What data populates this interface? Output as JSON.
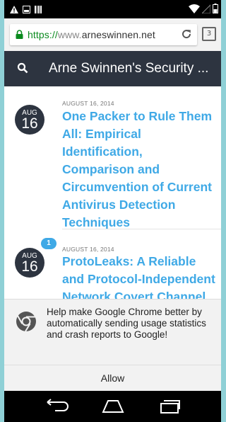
{
  "browser": {
    "url_scheme": "https://",
    "url_prefix": "www.",
    "url_domain": "arneswinnen.net",
    "tab_count": "3"
  },
  "site": {
    "title": "Arne Swinnen's Security ..."
  },
  "posts": [
    {
      "month": "AUG",
      "day": "16",
      "date": "AUGUST 16, 2014",
      "title": "One Packer to Rule Them All: Empirical Identification, Comparison and Circumvention of Current Antivirus Detection Techniques"
    },
    {
      "month": "AUG",
      "day": "16",
      "date": "AUGUST 16, 2014",
      "title": "ProtoLeaks: A Reliable and Protocol-Independent Network Covert Channel",
      "comments": "1"
    }
  ],
  "infobar": {
    "message": "Help make Google Chrome better by automatically sending usage statistics and crash reports to Google!",
    "allow_label": "Allow"
  },
  "colors": {
    "accent": "#3fa9e6",
    "header": "#2d3440",
    "secure": "#0a8a1e"
  }
}
